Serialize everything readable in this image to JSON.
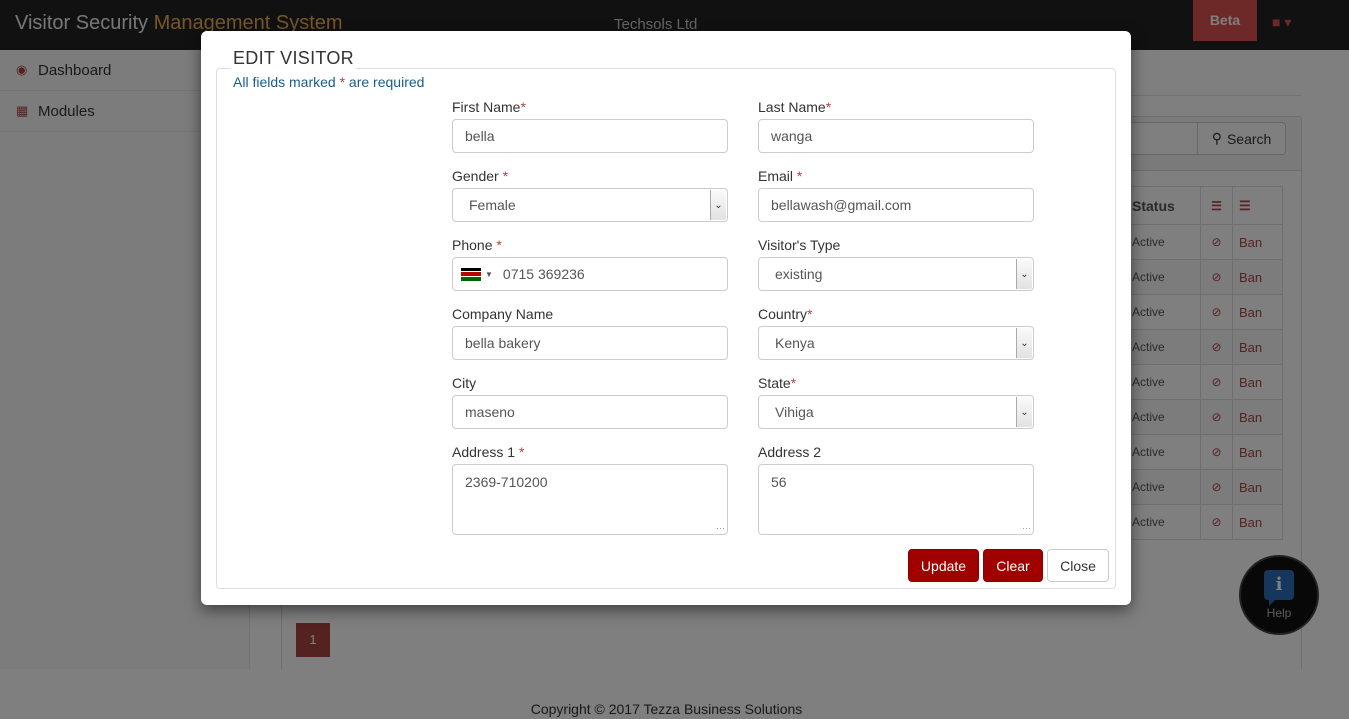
{
  "app": {
    "title_part1": "Visitor Security ",
    "title_part2": "Management System",
    "company": "Techsols Ltd",
    "beta_label": "Beta",
    "user_caret": "▾"
  },
  "sidebar": {
    "items": [
      {
        "label": "Dashboard",
        "icon": "dashboard-icon"
      },
      {
        "label": "Modules",
        "icon": "grid-icon"
      }
    ]
  },
  "search": {
    "button_label": "Search"
  },
  "table": {
    "headers": [
      "Status"
    ],
    "rows": [
      {
        "status": "Active",
        "action": "Ban"
      },
      {
        "status": "Active",
        "action": "Ban"
      },
      {
        "status": "Active",
        "action": "Ban"
      },
      {
        "status": "Active",
        "action": "Ban"
      },
      {
        "status": "Active",
        "action": "Ban"
      },
      {
        "status": "Active",
        "action": "Ban"
      },
      {
        "status": "Active",
        "action": "Ban"
      },
      {
        "status": "Active",
        "action": "Ban"
      },
      {
        "status": "Active",
        "action": "Ban"
      }
    ]
  },
  "pagination": {
    "current": "1"
  },
  "footer": {
    "text": "Copyright © 2017 Tezza Business Solutions"
  },
  "help": {
    "label": "Help",
    "glyph": "i"
  },
  "modal": {
    "title": "EDIT VISITOR",
    "required_note_a": "All fields marked ",
    "required_star": "*",
    "required_note_b": " are required",
    "fields": {
      "first_name": {
        "label": "First Name",
        "value": "bella"
      },
      "last_name": {
        "label": "Last Name",
        "value": "wanga"
      },
      "gender": {
        "label": "Gender ",
        "value": "Female"
      },
      "email": {
        "label": "Email ",
        "value": "bellawash@gmail.com"
      },
      "phone": {
        "label": "Phone ",
        "value": "0715 369236"
      },
      "visitor_type": {
        "label": "Visitor's Type",
        "value": "existing"
      },
      "company": {
        "label": "Company Name",
        "value": "bella bakery"
      },
      "country": {
        "label": "Country",
        "value": "Kenya"
      },
      "city": {
        "label": "City",
        "value": "maseno"
      },
      "state": {
        "label": "State",
        "value": "Vihiga"
      },
      "address1": {
        "label": "Address 1 ",
        "value": "2369-710200"
      },
      "address2": {
        "label": "Address 2",
        "value": "56"
      }
    },
    "buttons": {
      "update": "Update",
      "clear": "Clear",
      "close": "Close"
    }
  },
  "colors": {
    "accent_red": "#a00000",
    "brand_orange": "#f0ad4e",
    "link_blue": "#1b5c8a"
  }
}
